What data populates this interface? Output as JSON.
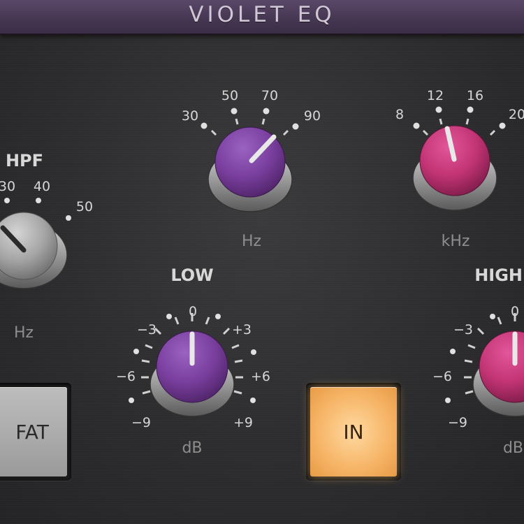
{
  "title": "VIOLET EQ",
  "hpf": {
    "name": "HPF",
    "unit": "Hz",
    "ticks": [
      "30",
      "40",
      "50"
    ]
  },
  "mid_freq": {
    "unit": "Hz",
    "ticks": [
      "30",
      "50",
      "70",
      "90"
    ]
  },
  "high_freq": {
    "unit": "kHz",
    "ticks": [
      "8",
      "12",
      "16",
      "20"
    ]
  },
  "low_gain": {
    "name": "LOW",
    "unit": "dB",
    "ticks": [
      "−3",
      "0",
      "+3",
      "−6",
      "+6",
      "−9",
      "+9"
    ]
  },
  "high_gain": {
    "name": "HIGH",
    "unit": "dB",
    "ticks": [
      "−3",
      "0",
      "−6",
      "−9"
    ]
  },
  "buttons": {
    "fat_label": "FAT",
    "in_label": "IN"
  },
  "colors": {
    "title_bar": "#463753",
    "violet_knob": "#7a3f9e",
    "pink_knob": "#c23474",
    "gray_knob": "#a0a0a0",
    "in_button": "#f6b466"
  }
}
